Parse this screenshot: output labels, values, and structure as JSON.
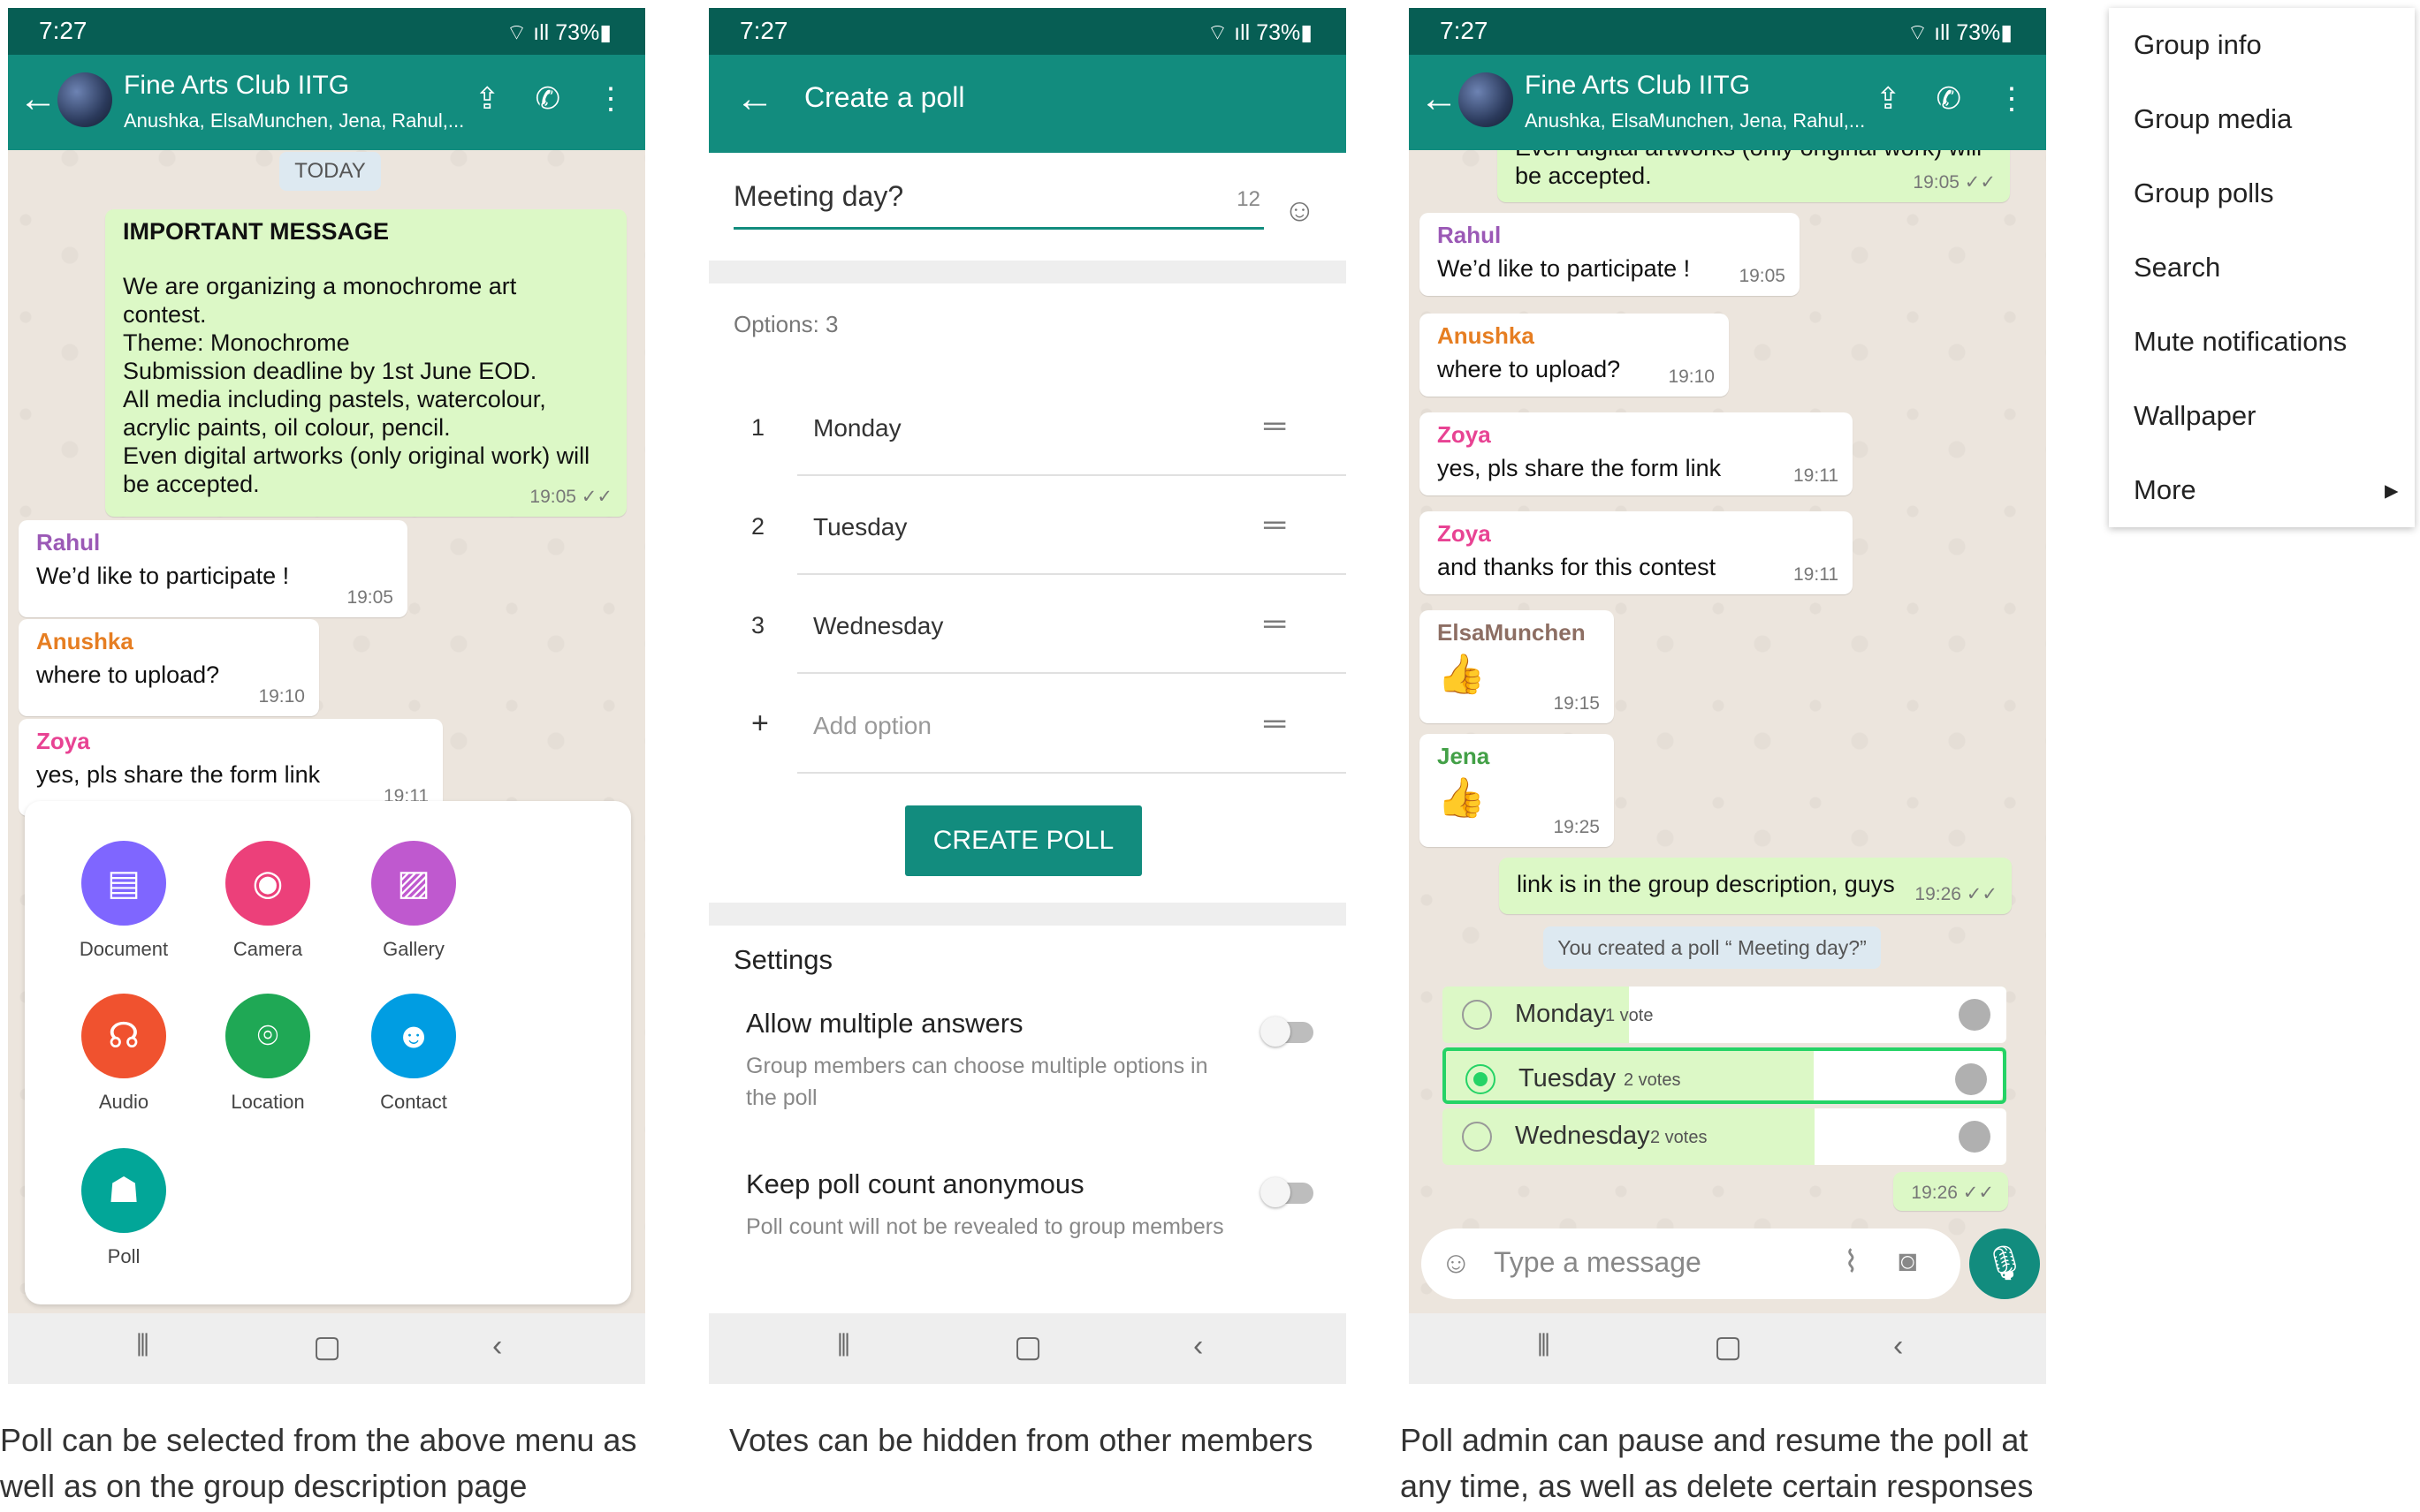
{
  "status": {
    "time": "7:27",
    "battery": "73%"
  },
  "group": {
    "title": "Fine Arts Club IITG",
    "members": "Anushka, ElsaMunchen, Jena, Rahul,..."
  },
  "screen1": {
    "date_chip": "TODAY",
    "important_title": "IMPORTANT MESSAGE",
    "announcement_lines": [
      "We are organizing a monochrome art",
      "contest.",
      "Theme: Monochrome",
      "Submission deadline by 1st June EOD.",
      "All media including pastels, watercolour,",
      "acrylic paints, oil colour, pencil.",
      "Even digital artworks (only original work) will",
      "be accepted."
    ],
    "announcement_time": "19:05",
    "messages": [
      {
        "sender": "Rahul",
        "text": "We’d like to participate !",
        "time": "19:05",
        "color": "#9b59b6"
      },
      {
        "sender": "Anushka",
        "text": "where to upload?",
        "time": "19:10",
        "color": "#e67e22"
      },
      {
        "sender": "Zoya",
        "text": "yes, pls share the form link",
        "time": "19:11",
        "color": "#e84393"
      }
    ],
    "attach_options": [
      {
        "label": "Document",
        "icon": "document-icon",
        "color": "#7f66ff"
      },
      {
        "label": "Camera",
        "icon": "camera-icon",
        "color": "#ec407a"
      },
      {
        "label": "Gallery",
        "icon": "gallery-icon",
        "color": "#bf59cf"
      },
      {
        "label": "Audio",
        "icon": "headphones-icon",
        "color": "#f0522f"
      },
      {
        "label": "Location",
        "icon": "location-pin-icon",
        "color": "#1fa855"
      },
      {
        "label": "Contact",
        "icon": "contact-icon",
        "color": "#009de2"
      },
      {
        "label": "Poll",
        "icon": "poll-icon",
        "color": "#02a698"
      }
    ],
    "caption": [
      "Poll can be selected from the above menu as",
      "well as on the group description page"
    ]
  },
  "screen2": {
    "title": "Create a poll",
    "question": "Meeting day?",
    "char_count": "12",
    "options_label": "Options: 3",
    "options": [
      {
        "num": "1",
        "text": "Monday"
      },
      {
        "num": "2",
        "text": "Tuesday"
      },
      {
        "num": "3",
        "text": "Wednesday"
      }
    ],
    "add_option": "Add option",
    "add_symbol": "+",
    "create_button": "CREATE POLL",
    "settings_title": "Settings",
    "setting1_title": "Allow multiple answers",
    "setting1_desc": "Group members can choose multiple options in the poll",
    "setting2_title": "Keep poll count anonymous",
    "setting2_desc": "Poll count will not be revealed to group members",
    "caption": "Votes can be hidden from other members"
  },
  "screen3": {
    "top_message": [
      "Even digital artworks (only original work) will",
      "be accepted."
    ],
    "top_time": "19:05",
    "messages": [
      {
        "sender": "Rahul",
        "text": "We’d like to participate !",
        "time": "19:05",
        "color": "#9b59b6"
      },
      {
        "sender": "Anushka",
        "text": "where to upload?",
        "time": "19:10",
        "color": "#e67e22"
      },
      {
        "sender": "Zoya",
        "text": "yes, pls share the form link",
        "time": "19:11",
        "color": "#e84393"
      },
      {
        "sender": "Zoya",
        "text": "and thanks for this contest",
        "time": "19:11",
        "color": "#e84393"
      },
      {
        "sender": "ElsaMunchen",
        "text": "👍",
        "time": "19:15",
        "color": "#8d6e63"
      },
      {
        "sender": "Jena",
        "text": "👍",
        "time": "19:25",
        "color": "#43a047"
      }
    ],
    "outgoing": {
      "text": "link is in the group description, guys",
      "time": "19:26"
    },
    "system_msg": "You created a poll “ Meeting day?”",
    "poll": [
      {
        "label": "Monday",
        "votes": "1 vote",
        "share": 0.33
      },
      {
        "label": "Tuesday",
        "votes": "2 votes",
        "share": 0.66
      },
      {
        "label": "Wednesday",
        "votes": "2 votes",
        "share": 0.66
      }
    ],
    "poll_time": "19:26",
    "input_placeholder": "Type a message",
    "caption": [
      "Poll admin can pause and resume the poll at",
      "any time, as well as delete certain responses"
    ]
  },
  "menu": {
    "items": [
      "Group info",
      "Group media",
      "Group polls",
      "Search",
      "Mute notifications",
      "Wallpaper",
      "More"
    ]
  }
}
